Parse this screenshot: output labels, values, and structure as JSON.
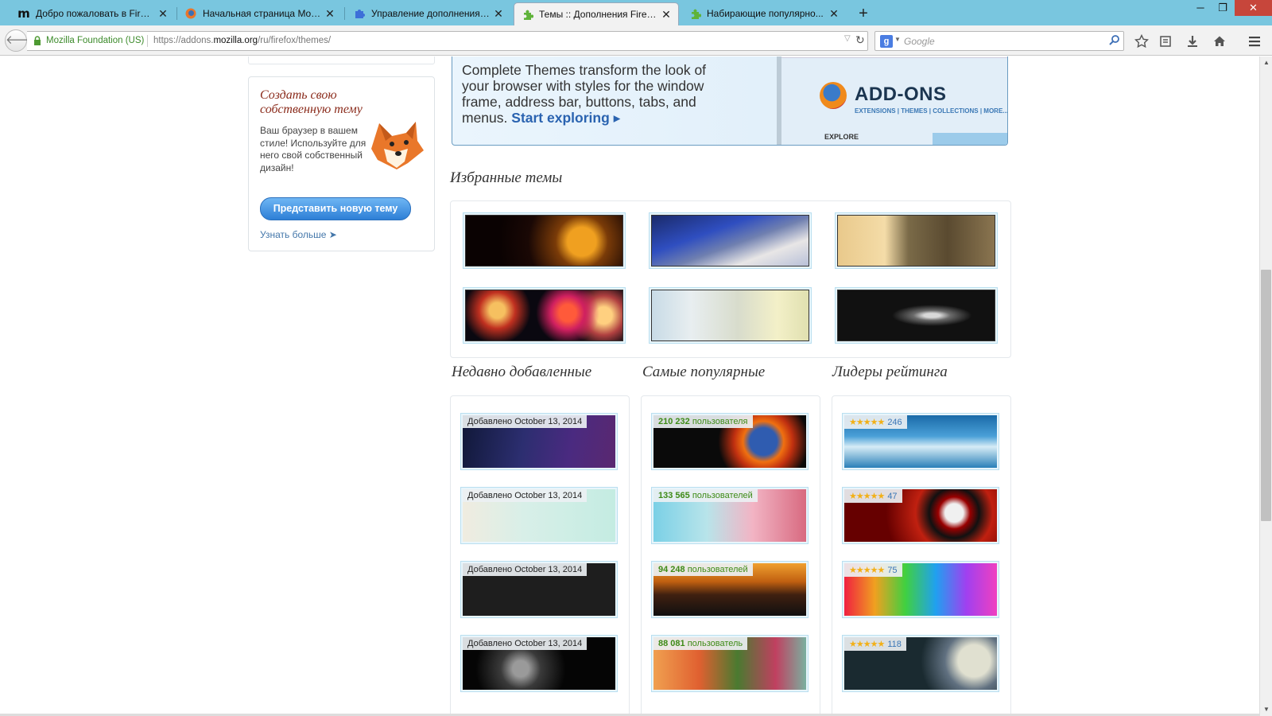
{
  "tabs": [
    {
      "label": "Добро пожаловать в Firefox",
      "icon": "mozilla-m-icon"
    },
    {
      "label": "Начальная страница Mozi...",
      "icon": "firefox-icon"
    },
    {
      "label": "Управление дополнениями",
      "icon": "puzzle-icon"
    },
    {
      "label": "Темы :: Дополнения Firefox",
      "icon": "addon-icon"
    },
    {
      "label": "Набирающие популярно...",
      "icon": "addon-icon"
    }
  ],
  "nav": {
    "identity": "Mozilla Foundation (US)",
    "url_prefix": "https://addons.",
    "url_domain": "mozilla.org",
    "url_path": "/ru/firefox/themes/",
    "search_placeholder": "Google"
  },
  "sidebar": {
    "create_title": "Создать свою собственную тему",
    "create_desc": "Ваш браузер в вашем стиле! Используйте для него свой собственный дизайн!",
    "submit_label": "Представить новую тему",
    "learn_more": "Узнать больше ➤"
  },
  "promo": {
    "text": "Complete Themes transform the look of your browser with styles for the window frame, address bar, buttons, tabs, and menus.",
    "link": "Start exploring ▸",
    "brand": "ADD-ONS",
    "brand_nav": "EXTENSIONS  |  THEMES  |  COLLECTIONS  |  MORE...",
    "explore": "EXPLORE"
  },
  "featured": {
    "heading": "Избранные темы"
  },
  "recent": {
    "heading": "Недавно добавленные",
    "items": [
      {
        "label": "Добавлено October 13, 2014"
      },
      {
        "label": "Добавлено October 13, 2014"
      },
      {
        "label": "Добавлено October 13, 2014"
      },
      {
        "label": "Добавлено October 13, 2014"
      }
    ]
  },
  "popular": {
    "heading": "Самые популярные",
    "items": [
      {
        "count": "210 232",
        "word": "пользователя"
      },
      {
        "count": "133 565",
        "word": "пользователей"
      },
      {
        "count": "94 248",
        "word": "пользователей"
      },
      {
        "count": "88 081",
        "word": "пользователь"
      }
    ]
  },
  "top_rated": {
    "heading": "Лидеры рейтинга",
    "items": [
      {
        "stars": "★★★★★",
        "count": "246"
      },
      {
        "stars": "★★★★★",
        "count": "47"
      },
      {
        "stars": "★★★★★",
        "count": "75"
      },
      {
        "stars": "★★★★★",
        "count": "118"
      }
    ]
  },
  "colors": {
    "tabbar": "#79c6df",
    "accent_link": "#2a63b0",
    "users_green": "#3d8a16",
    "button_blue": "#2d7fd6"
  }
}
